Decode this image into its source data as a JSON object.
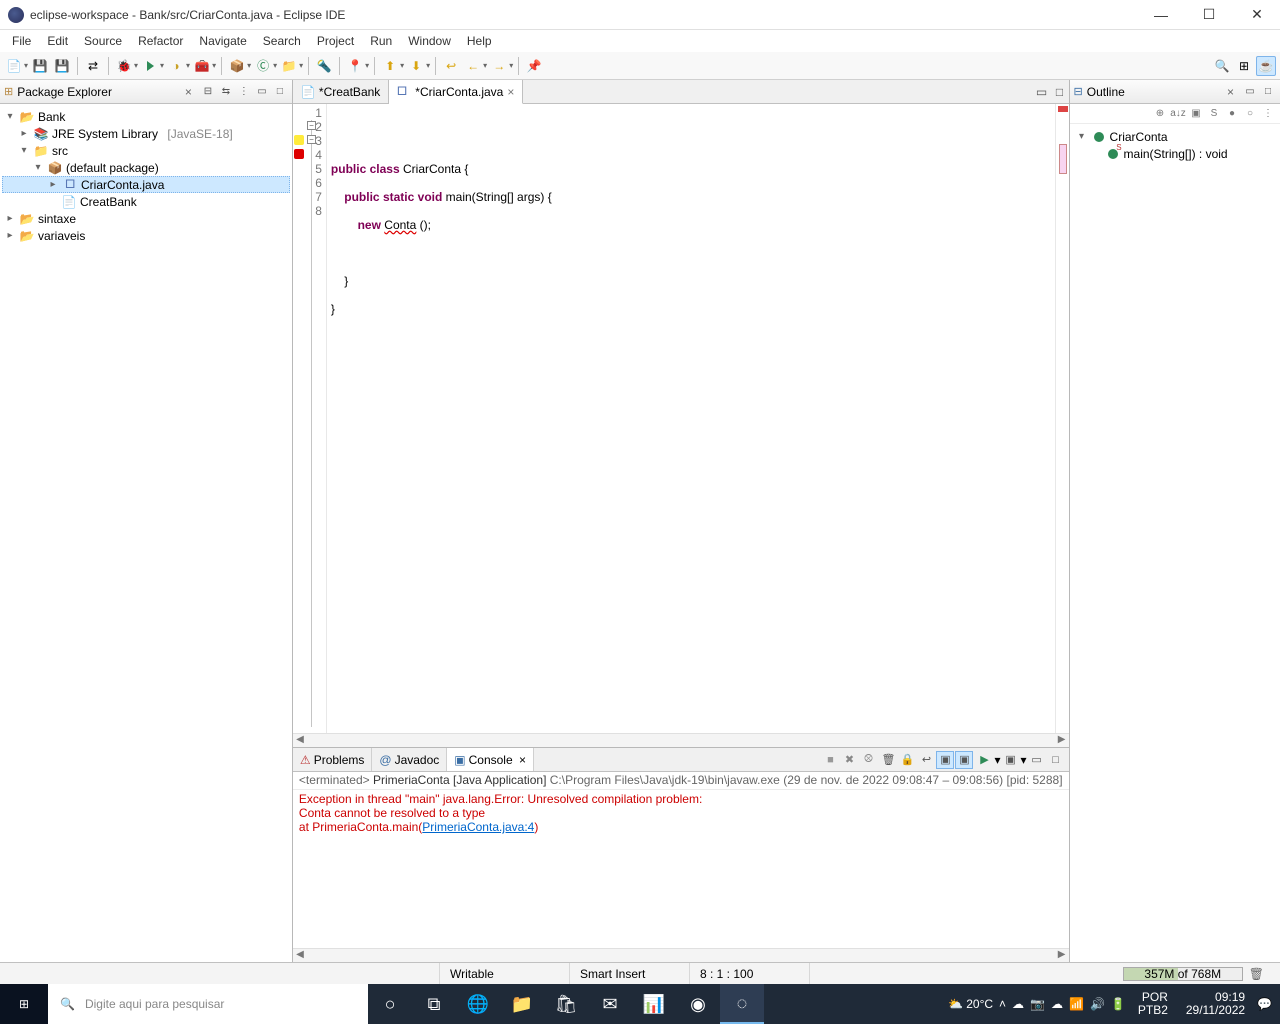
{
  "window": {
    "title": "eclipse-workspace - Bank/src/CriarConta.java - Eclipse IDE"
  },
  "menubar": [
    "File",
    "Edit",
    "Source",
    "Refactor",
    "Navigate",
    "Search",
    "Project",
    "Run",
    "Window",
    "Help"
  ],
  "package_explorer": {
    "title": "Package Explorer",
    "tree": {
      "project": "Bank",
      "jre": "JRE System Library",
      "jre_version": "[JavaSE-18]",
      "src": "src",
      "default_pkg": "(default package)",
      "file_main": "CriarConta.java",
      "file_other": "CreatBank",
      "sibling1": "sintaxe",
      "sibling2": "variaveis"
    }
  },
  "editor": {
    "tabs": [
      {
        "label": "*CreatBank",
        "active": false
      },
      {
        "label": "*CriarConta.java",
        "active": true
      }
    ],
    "lines": [
      "",
      "public class CriarConta {",
      "    public static void main(String[] args) {",
      "        new Conta ();",
      "",
      "    }",
      "}",
      ""
    ],
    "line_numbers": [
      "1",
      "2",
      "3",
      "4",
      "5",
      "6",
      "7",
      "8"
    ]
  },
  "outline": {
    "title": "Outline",
    "class": "CriarConta",
    "method": "main(String[]) : void"
  },
  "bottom": {
    "tabs": [
      {
        "label": "Problems",
        "active": false
      },
      {
        "label": "Javadoc",
        "active": false
      },
      {
        "label": "Console",
        "active": true
      }
    ],
    "console_desc_prefix": "<terminated>",
    "console_desc_name": "PrimeriaConta [Java Application]",
    "console_desc_path": "C:\\Program Files\\Java\\jdk-19\\bin\\javaw.exe",
    "console_desc_time": "(29 de nov. de 2022 09:08:47 – 09:08:56) [pid: 5288]",
    "console_lines": [
      "Exception in thread \"main\" java.lang.Error: Unresolved compilation problem:",
      "        Conta cannot be resolved to a type",
      "",
      "        at PrimeriaConta.main("
    ],
    "console_link": "PrimeriaConta.java:4",
    "console_close": ")"
  },
  "status": {
    "writable": "Writable",
    "insert": "Smart Insert",
    "cursor": "8 : 1 : 100",
    "heap": "357M of 768M",
    "heap_pct": 46
  },
  "taskbar": {
    "search_placeholder": "Digite aqui para pesquisar",
    "weather": "20°C",
    "lang": "POR",
    "kbd": "PTB2",
    "time": "09:19",
    "date": "29/11/2022"
  }
}
